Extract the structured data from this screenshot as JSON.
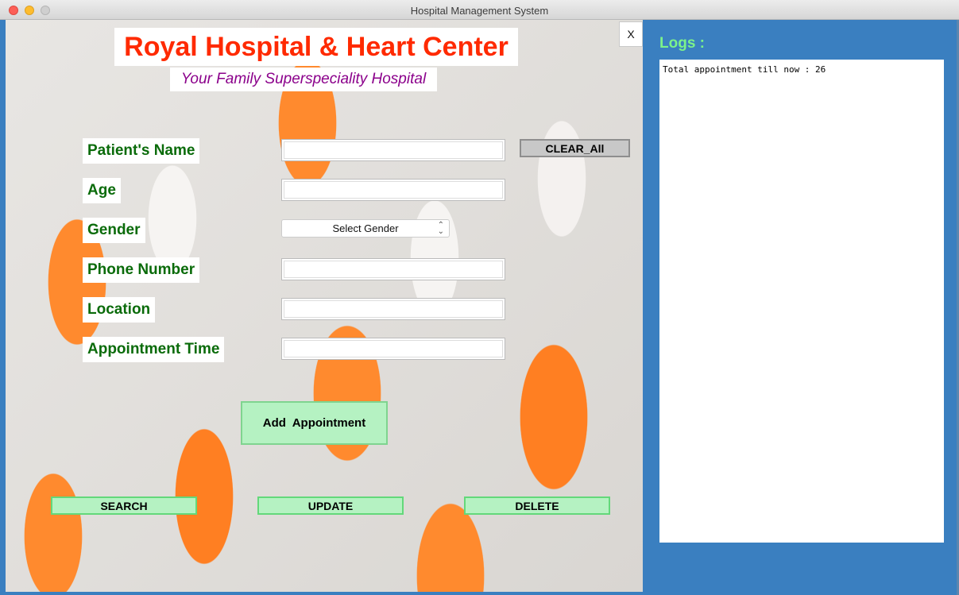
{
  "window": {
    "title": "Hospital Management System"
  },
  "header": {
    "title": "Royal Hospital & Heart Center",
    "subtitle": "Your Family Superspeciality Hospital",
    "close_label": "X"
  },
  "form": {
    "fields": [
      {
        "label": "Patient's Name",
        "value": ""
      },
      {
        "label": "Age",
        "value": ""
      },
      {
        "label": "Gender",
        "selected": "Select Gender"
      },
      {
        "label": "Phone Number",
        "value": ""
      },
      {
        "label": "Location",
        "value": ""
      },
      {
        "label": "Appointment Time",
        "value": ""
      }
    ],
    "clear_label": "CLEAR_All",
    "add_label": "Add  Appointment"
  },
  "actions": {
    "search": "SEARCH",
    "update": "UPDATE",
    "delete": "DELETE"
  },
  "logs": {
    "title": "Logs :",
    "text": "Total appointment till now : 26"
  },
  "colors": {
    "title_red": "#ff2a00",
    "subtitle_purple": "#8b008b",
    "label_green": "#0a6b0a",
    "button_green": "#b5f2c2",
    "panel_blue": "#3a7fc0",
    "logs_title_green": "#7cf28a"
  },
  "icons": {
    "gender_dropdown": "chevron-updown-icon"
  }
}
